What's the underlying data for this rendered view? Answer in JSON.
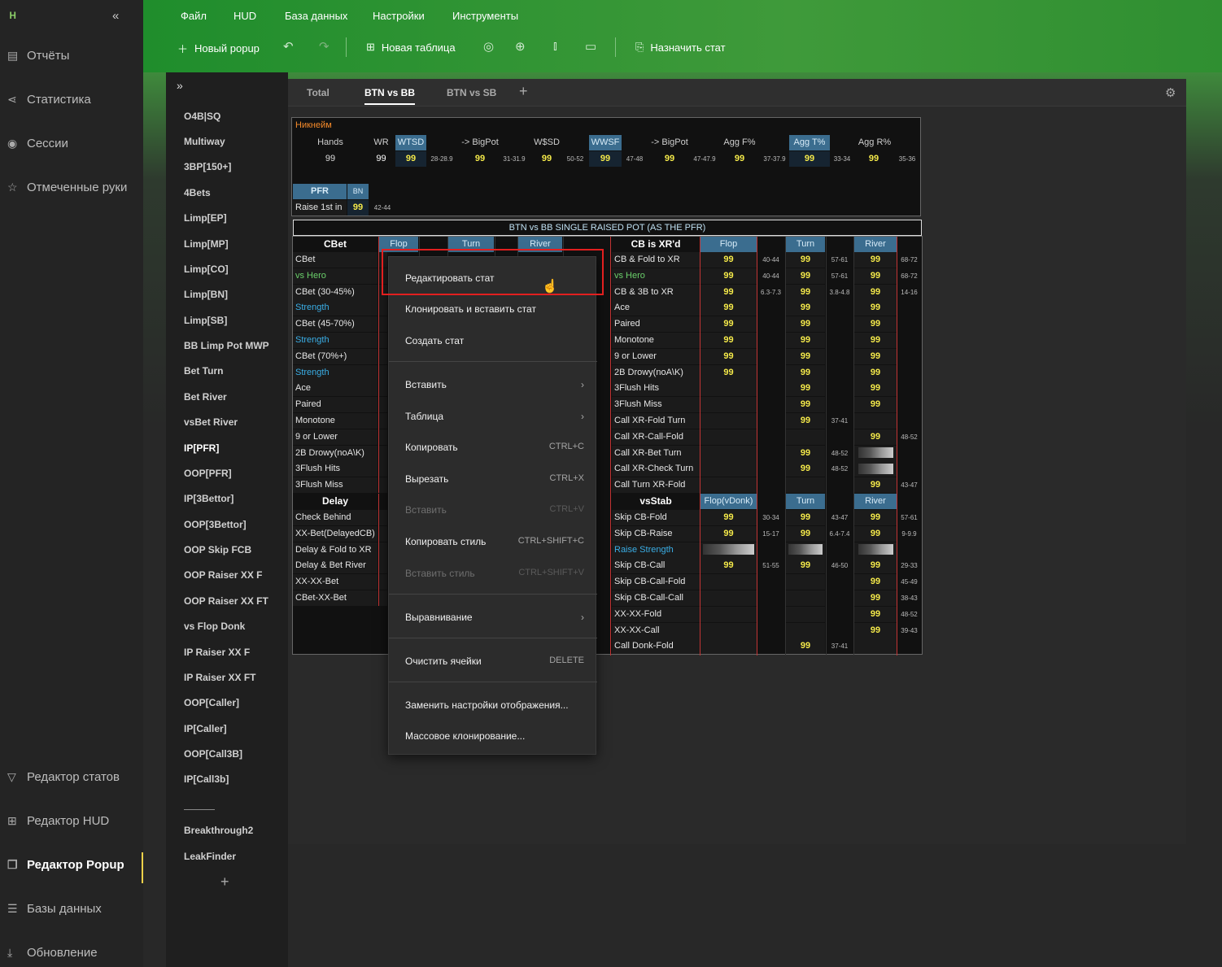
{
  "app": {
    "logo": "ᴴ"
  },
  "sidebar": {
    "items": [
      {
        "label": "Отчёты",
        "icon": "report-icon"
      },
      {
        "label": "Статистика",
        "icon": "share-nodes-icon"
      },
      {
        "label": "Сессии",
        "icon": "broadcast-icon"
      },
      {
        "label": "Отмеченные руки",
        "icon": "star-list-icon"
      },
      {
        "label": "Редактор статов",
        "icon": "filter-icon"
      },
      {
        "label": "Редактор HUD",
        "icon": "layout-icon"
      },
      {
        "label": "Редактор Popup",
        "icon": "popup-icon"
      },
      {
        "label": "Базы данных",
        "icon": "database-icon"
      },
      {
        "label": "Обновление",
        "icon": "download-icon"
      }
    ]
  },
  "menubar": {
    "items": [
      "Файл",
      "HUD",
      "База данных",
      "Настройки",
      "Инструменты"
    ]
  },
  "toolbar": {
    "new_popup": "Новый popup",
    "new_table": "Новая таблица",
    "assign_stat": "Назначить стат"
  },
  "popup_list": {
    "items": [
      "O4B|SQ",
      "Multiway",
      "3BP[150+]",
      "4Bets",
      "Limp[EP]",
      "Limp[MP]",
      "Limp[CO]",
      "Limp[BN]",
      "Limp[SB]",
      "BB Limp Pot MWP",
      "Bet Turn",
      "Bet River",
      "vsBet River",
      "IP[PFR]",
      "OOP[PFR]",
      "IP[3Bettor]",
      "OOP[3Bettor]",
      "OOP Skip FCB",
      "OOP Raiser XX F",
      "OOP Raiser XX FT",
      "vs Flop Donk",
      "IP Raiser XX F",
      "IP Raiser XX FT",
      "OOP[Caller]",
      "IP[Caller]",
      "OOP[Call3B]",
      "IP[Call3b]"
    ],
    "extra": [
      "Breakthrough2",
      "LeakFinder"
    ]
  },
  "tabs": [
    "Total",
    "BTN vs BB",
    "BTN vs SB"
  ],
  "top_grid": {
    "nickname": "Никнейм",
    "headers": [
      "Hands",
      "WR",
      "WTSD",
      "-> BigPot",
      "W$SD",
      "WWSF",
      "-> BigPot",
      "Agg F%",
      "Agg T%",
      "Agg R%"
    ],
    "values": [
      "99",
      "99",
      "99",
      "99",
      "99",
      "99",
      "99",
      "99",
      "99",
      "99"
    ],
    "ranges": [
      "28-28.9",
      "31-31.9",
      "50-52",
      "47-48",
      "47-47.9",
      "37-37.9",
      "33-34",
      "35-36"
    ],
    "pfr": "PFR",
    "bn": "BN",
    "raise1st": "Raise 1st in",
    "raise1st_val": "99",
    "raise1st_rng": "42-44"
  },
  "section_title": "BTN vs BB SINGLE RAISED POT (AS THE PFR)",
  "left_table": {
    "header": "CBet",
    "cols": [
      "Flop",
      "Turn",
      "River"
    ],
    "rows": [
      "CBet",
      "vs Hero",
      "CBet (30-45%)",
      "Strength",
      "CBet (45-70%)",
      "Strength",
      "CBet (70%+)",
      "Strength",
      "Ace",
      "Paired",
      "Monotone",
      "9 or Lower",
      "2B Drowy(noA\\K)",
      "3Flush Hits",
      "3Flush Miss"
    ],
    "delay_header": "Delay",
    "delay_rows": [
      "Check Behind",
      "XX-Bet(DelayedCB)",
      "Delay & Fold to XR",
      "Delay & Bet River",
      "XX-XX-Bet",
      "CBet-XX-Bet"
    ]
  },
  "right_table": {
    "header": "CB is XR'd",
    "cols": [
      "Flop",
      "Turn",
      "River"
    ],
    "rows": [
      {
        "label": "CB & Fold to XR",
        "f": "99",
        "fr": "40-44",
        "t": "99",
        "tr": "57-61",
        "r": "99",
        "rr": "68-72"
      },
      {
        "label": "vs Hero",
        "f": "99",
        "fr": "40-44",
        "t": "99",
        "tr": "57-61",
        "r": "99",
        "rr": "68-72"
      },
      {
        "label": "CB & 3B to XR",
        "f": "99",
        "fr": "6.3-7.3",
        "t": "99",
        "tr": "3.8-4.8",
        "r": "99",
        "rr": "14-16"
      },
      {
        "label": "Ace",
        "f": "99",
        "t": "99",
        "r": "99"
      },
      {
        "label": "Paired",
        "f": "99",
        "t": "99",
        "r": "99"
      },
      {
        "label": "Monotone",
        "f": "99",
        "t": "99",
        "r": "99"
      },
      {
        "label": "9 or Lower",
        "f": "99",
        "t": "99",
        "r": "99"
      },
      {
        "label": "2B Drowy(noA\\K)",
        "f": "99",
        "t": "99",
        "r": "99"
      },
      {
        "label": "3Flush Hits",
        "t": "99",
        "r": "99"
      },
      {
        "label": "3Flush Miss",
        "t": "99",
        "r": "99"
      },
      {
        "label": "Call XR-Fold Turn",
        "t": "99",
        "tr": "37-41"
      },
      {
        "label": "Call XR-Call-Fold",
        "r": "99",
        "rr": "48-52"
      },
      {
        "label": "Call XR-Bet Turn",
        "t": "99",
        "tr": "48-52"
      },
      {
        "label": "Call XR-Check Turn",
        "t": "99",
        "tr": "48-52"
      },
      {
        "label": "Call Turn XR-Fold",
        "r": "99",
        "rr": "43-47"
      }
    ],
    "vsstab_header": "vsStab",
    "vsstab_cols": [
      "Flop(vDonk)",
      "Turn",
      "River"
    ],
    "vsstab_rows": [
      {
        "label": "Skip CB-Fold",
        "f": "99",
        "fr": "30-34",
        "t": "99",
        "tr": "43-47",
        "r": "99",
        "rr": "57-61"
      },
      {
        "label": "Skip CB-Raise",
        "f": "99",
        "fr": "15-17",
        "t": "99",
        "tr": "6.4-7.4",
        "r": "99",
        "rr": "9-9.9"
      },
      {
        "label": "Raise Strength"
      },
      {
        "label": "Skip CB-Call",
        "f": "99",
        "fr": "51-55",
        "t": "99",
        "tr": "46-50",
        "r": "99",
        "rr": "29-33"
      },
      {
        "label": "Skip CB-Call-Fold",
        "r": "99",
        "rr": "45-49"
      },
      {
        "label": "Skip CB-Call-Call",
        "r": "99",
        "rr": "38-43"
      },
      {
        "label": "XX-XX-Fold",
        "r": "99",
        "rr": "48-52"
      },
      {
        "label": "XX-XX-Call",
        "r": "99",
        "rr": "39-43"
      },
      {
        "label": "Call Donk-Fold",
        "t": "99",
        "tr": "37-41"
      }
    ]
  },
  "context_menu": {
    "items": [
      {
        "label": "Редактировать стат"
      },
      {
        "label": "Клонировать и вставить стат"
      },
      {
        "label": "Создать стат"
      },
      {
        "label": "Вставить",
        "arrow": "›"
      },
      {
        "label": "Таблица",
        "arrow": "›"
      },
      {
        "label": "Копировать",
        "shortcut": "CTRL+C"
      },
      {
        "label": "Вырезать",
        "shortcut": "CTRL+X"
      },
      {
        "label": "Вставить",
        "shortcut": "CTRL+V",
        "disabled": true
      },
      {
        "label": "Копировать стиль",
        "shortcut": "CTRL+SHIFT+C"
      },
      {
        "label": "Вставить стиль",
        "shortcut": "CTRL+SHIFT+V",
        "disabled": true
      },
      {
        "label": "Выравнивание",
        "arrow": "›"
      },
      {
        "label": "Очистить ячейки",
        "shortcut": "DELETE"
      },
      {
        "label": "Заменить настройки отображения..."
      },
      {
        "label": "Массовое клонирование..."
      }
    ]
  }
}
